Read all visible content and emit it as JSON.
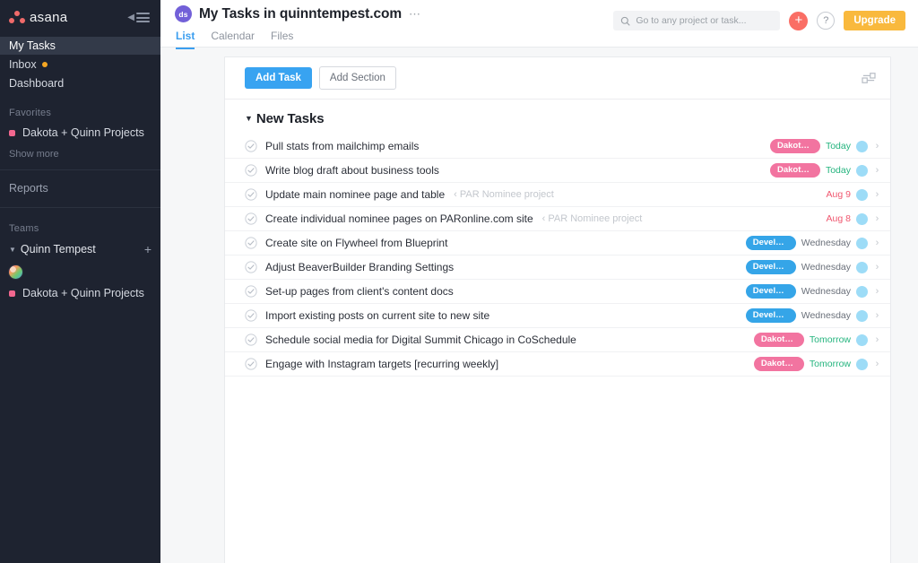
{
  "sidebar": {
    "logo_text": "asana",
    "logo_icon": "asana-logo-dots",
    "collapse_icon": "collapse-sidebar-icon",
    "nav": [
      {
        "label": "My Tasks",
        "active": true,
        "badge": false
      },
      {
        "label": "Inbox",
        "active": false,
        "badge": true
      },
      {
        "label": "Dashboard",
        "active": false,
        "badge": false
      }
    ],
    "favorites_label": "Favorites",
    "favorites": [
      {
        "label": "Dakota + Quinn Projects",
        "color": "#f2678f"
      }
    ],
    "show_more_label": "Show more",
    "reports_label": "Reports",
    "teams_label": "Teams",
    "team_name": "Quinn Tempest",
    "team_add_icon": "plus-icon",
    "team_caret_icon": "caret-down-icon",
    "team_avatar": "user-avatar",
    "team_projects": [
      {
        "label": "Dakota + Quinn Projects",
        "color": "#f2678f"
      }
    ]
  },
  "header": {
    "avatar_initials": "ds",
    "title": "My Tasks in quinntempest.com",
    "more_icon": "ellipsis-icon",
    "tabs": [
      {
        "label": "List",
        "active": true
      },
      {
        "label": "Calendar",
        "active": false
      },
      {
        "label": "Files",
        "active": false
      }
    ],
    "search": {
      "placeholder": "Go to any project or task...",
      "value": "",
      "icon": "search-icon"
    },
    "add_button_icon": "plus-icon",
    "add_button_label": "+",
    "help_button_label": "?",
    "help_button_icon": "question-mark-icon",
    "upgrade_label": "Upgrade"
  },
  "toolbar": {
    "add_task_label": "Add Task",
    "add_section_label": "Add Section",
    "sliders_icon": "sliders-settings-icon"
  },
  "section": {
    "caret_icon": "caret-down-icon",
    "title": "New Tasks"
  },
  "colors": {
    "sidebar_bg": "#1e2330",
    "accent_blue": "#38a3f1",
    "upgrade_yellow": "#f9b93d",
    "add_coral": "#fa6e65",
    "pill_pink": "#f274a0",
    "pill_blue": "#35a5e8",
    "due_green": "#24b47e",
    "due_red": "#f0576f",
    "avatar_purple": "#7260d8"
  },
  "tasks": [
    {
      "name": "Pull stats from mailchimp emails",
      "project": "",
      "tag": "Dakota +...",
      "tag_color": "pink",
      "due": "Today",
      "due_color": "green"
    },
    {
      "name": "Write blog draft about business tools",
      "project": "",
      "tag": "Dakota +...",
      "tag_color": "pink",
      "due": "Today",
      "due_color": "green"
    },
    {
      "name": "Update main nominee page and table",
      "project": "‹ PAR Nominee project",
      "tag": "",
      "tag_color": "",
      "due": "Aug 9",
      "due_color": "red"
    },
    {
      "name": "Create individual nominee pages on PARonline.com site",
      "project": "‹ PAR Nominee project",
      "tag": "",
      "tag_color": "",
      "due": "Aug 8",
      "due_color": "red"
    },
    {
      "name": "Create site on Flywheel from Blueprint",
      "project": "",
      "tag": "Develop...",
      "tag_color": "blue",
      "due": "Wednesday",
      "due_color": "gray"
    },
    {
      "name": "Adjust BeaverBuilder Branding Settings",
      "project": "",
      "tag": "Develop...",
      "tag_color": "blue",
      "due": "Wednesday",
      "due_color": "gray"
    },
    {
      "name": "Set-up pages from client's content docs",
      "project": "",
      "tag": "Develop...",
      "tag_color": "blue",
      "due": "Wednesday",
      "due_color": "gray"
    },
    {
      "name": "Import existing posts on current site to new site",
      "project": "",
      "tag": "Develop...",
      "tag_color": "blue",
      "due": "Wednesday",
      "due_color": "gray"
    },
    {
      "name": "Schedule social media for Digital Summit Chicago in CoSchedule",
      "project": "",
      "tag": "Dakota +...",
      "tag_color": "pink",
      "due": "Tomorrow",
      "due_color": "green"
    },
    {
      "name": "Engage with Instagram targets [recurring weekly]",
      "project": "",
      "tag": "Dakota +...",
      "tag_color": "pink",
      "due": "Tomorrow",
      "due_color": "green"
    }
  ]
}
